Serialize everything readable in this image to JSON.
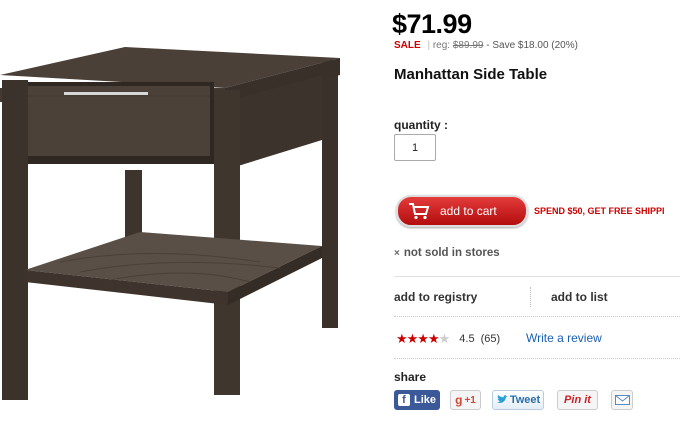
{
  "product": {
    "price": "$71.99",
    "sale_label": "SALE",
    "reg_label": "reg:",
    "reg_price": "$89.99",
    "save_text": "- Save  $18.00  (20%)",
    "title": "Manhattan Side Table",
    "image_icon": "side-table-photo"
  },
  "purchase": {
    "quantity_label": "quantity :",
    "quantity_value": "1",
    "add_to_cart_label": "add to cart",
    "promo_text": "SPEND $50, GET FREE SHIPPI",
    "not_in_stores": "not sold in stores",
    "not_in_stores_icon": "×"
  },
  "actions": {
    "add_to_registry": "add to registry",
    "add_to_list": "add to list"
  },
  "rating": {
    "stars_value": 4.5,
    "stars_max": 5,
    "score": "4.5",
    "count": "(65)",
    "write_review": "Write a review"
  },
  "share": {
    "label": "share",
    "facebook": "Like",
    "facebook_glyph": "f",
    "gplus": "+1",
    "gplus_glyph": "g",
    "twitter": "Tweet",
    "pinterest": "Pin it",
    "email_icon": "envelope-icon"
  },
  "colors": {
    "sale_red": "#cc0000",
    "link_blue": "#1a5fb4",
    "facebook_blue": "#3b5998"
  }
}
